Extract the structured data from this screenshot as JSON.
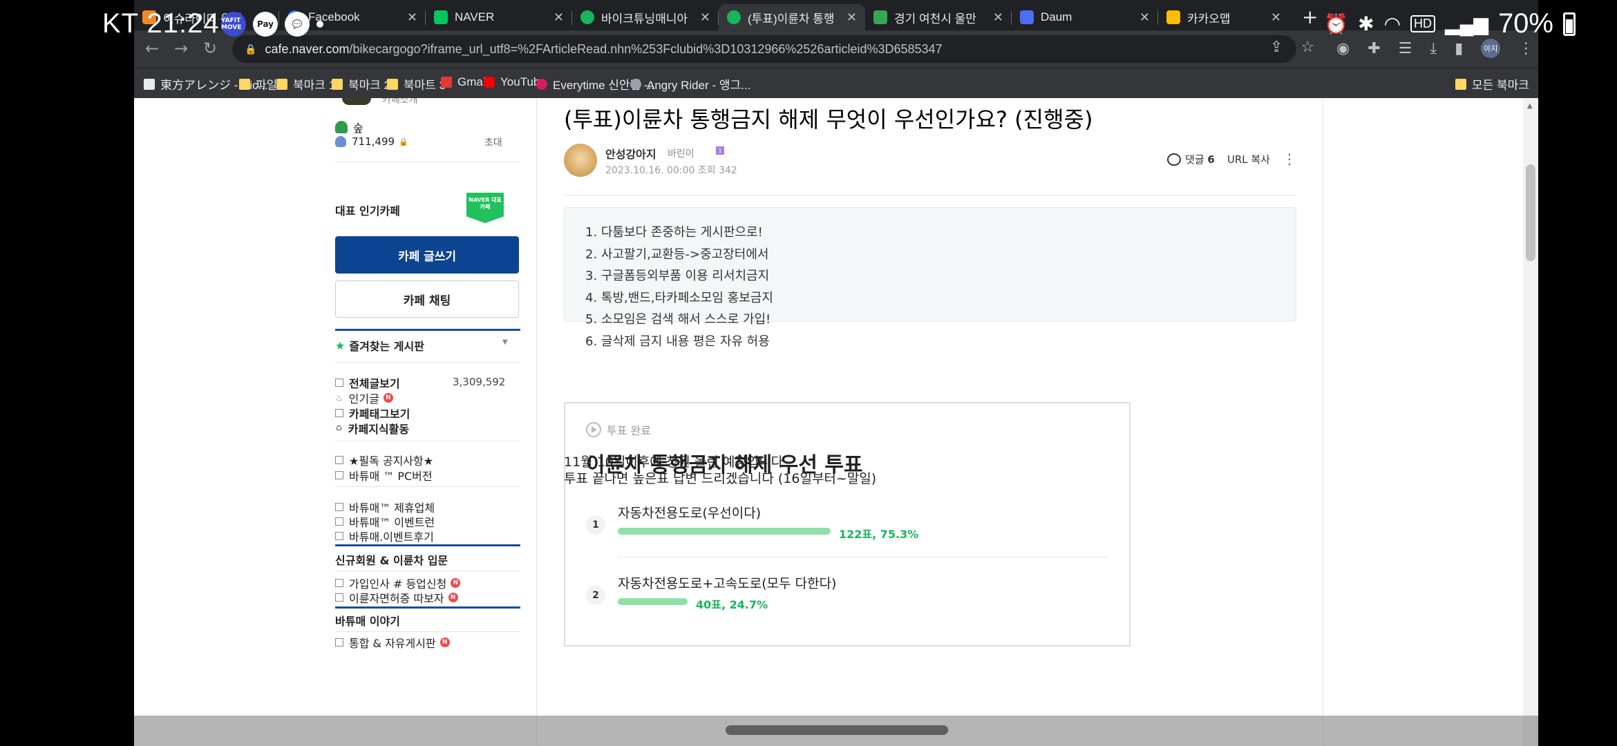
{
  "status_bar": {
    "carrier": "KT",
    "time": "21:24",
    "notif_icons": [
      "YAFIT MOVE",
      "Pay",
      "chat"
    ],
    "hd": "HD",
    "battery": "70%"
  },
  "browser": {
    "tabs": [
      {
        "title": "이슈라이더 유입",
        "favicon": "orange"
      },
      {
        "title": "Facebook",
        "favicon": "#1877f2"
      },
      {
        "title": "NAVER",
        "favicon": "#03c75a"
      },
      {
        "title": "바이크튜닝매니아",
        "favicon": "#19b55a"
      },
      {
        "title": "(투표)이륜차 통행",
        "favicon": "#19b55a",
        "active": true
      },
      {
        "title": "경기 여천시 울만",
        "favicon": "#34a853"
      },
      {
        "title": "Daum",
        "favicon": "#4b6ef5"
      },
      {
        "title": "카카오맵",
        "favicon": "#fbbc04"
      }
    ],
    "url_host": "cafe.naver.com",
    "url_path": "/bikecargogo?iframe_url_utf8=%2FArticleRead.nhn%253Fclubid%3D10312966%2526articleid%3D6585347",
    "bookmarks": [
      {
        "label": "東方アレンジ - Nic...",
        "icon": "white"
      },
      {
        "label": "파일",
        "icon": "folder"
      },
      {
        "label": "북마크 1",
        "icon": "folder"
      },
      {
        "label": "북마크 2",
        "icon": "folder"
      },
      {
        "label": "북마트 3",
        "icon": "folder"
      },
      {
        "label": "Gmail",
        "icon": "red"
      },
      {
        "label": "YouTube",
        "icon": "yt"
      },
      {
        "label": "Everytime 신안점 -...",
        "icon": "pink"
      },
      {
        "label": "Angry Rider - 앵그...",
        "icon": "grey"
      }
    ],
    "all_bookmarks": "모든 북마크",
    "profile": "아지"
  },
  "sidebar": {
    "cafe_sub": "카페소개",
    "level_label": "숲",
    "member_count": "711,499",
    "invite": "초대",
    "popular_label": "대표 인기카페",
    "naver_badge": "NAVER 대표카페",
    "write_button": "카페 글쓰기",
    "chat_button": "카페 채팅",
    "favorites_header": "즐겨찾는 게시판",
    "menu1": [
      {
        "label": "전체글보기",
        "count": "3,309,592"
      },
      {
        "label": "인기글",
        "new": true
      },
      {
        "label": "카페태그보기"
      },
      {
        "label": "카페지식활동"
      }
    ],
    "menu2": [
      {
        "label": "★필독 공지사항★"
      },
      {
        "label": "바튜매 ™ PC버전"
      }
    ],
    "menu3": [
      {
        "label": "바튜매™ 제휴업체"
      },
      {
        "label": "바튜매™ 이벤트런"
      },
      {
        "label": "바튜매.이벤트후기"
      }
    ],
    "section_new": "신규회원 & 이륜차 입문",
    "menu4": [
      {
        "label": "가입인사 # 등업신청",
        "new": true
      },
      {
        "label": "이륜자면허증 따보자",
        "new": true
      }
    ],
    "section_story": "바튜매 이야기",
    "menu5": [
      {
        "label": "통합 & 자유게시판",
        "new": true
      }
    ]
  },
  "article": {
    "title": "(투표)이륜차 통행금지 해제 무엇이 우선인가요? (진행중)",
    "author": "안성강아지",
    "grade": "바린이",
    "date": "2023.10.16. 00:00",
    "views": "조회 342",
    "comment_label": "댓글",
    "comment_count": "6",
    "url_copy": "URL 복사",
    "notice_lines": [
      "1. 다툼보다 존중하는 게시판으로!",
      "2. 사고팔기,교환등->중고장터에서",
      "3. 구글폼등외부품 이용 리서치금지",
      "4. 톡방,밴드,타카페소모임 홍보금지",
      "5. 소모임은 검색 해서 스스로 가입!",
      "6. 글삭제 금지 내용 평은 자유 허용"
    ],
    "poll": {
      "status": "투표 완료",
      "title": "이륜차 통행금지 해제 우선 투표",
      "options": [
        {
          "num": "1",
          "label": "자동차전용도로(우선이다)",
          "votes": 122,
          "percent": 75.3,
          "result": "122표, 75.3%"
        },
        {
          "num": "2",
          "label": "자동차전용도로+고속도로(모두 다한다)",
          "votes": 40,
          "percent": 24.7,
          "result": "40표, 24.7%"
        }
      ]
    },
    "body_lines": [
      "11월 10일이후에 청원 올린 예정입니다",
      "투표 끝나면 높은표 답변 드리겠습니다 (16일부터~말일)"
    ]
  }
}
